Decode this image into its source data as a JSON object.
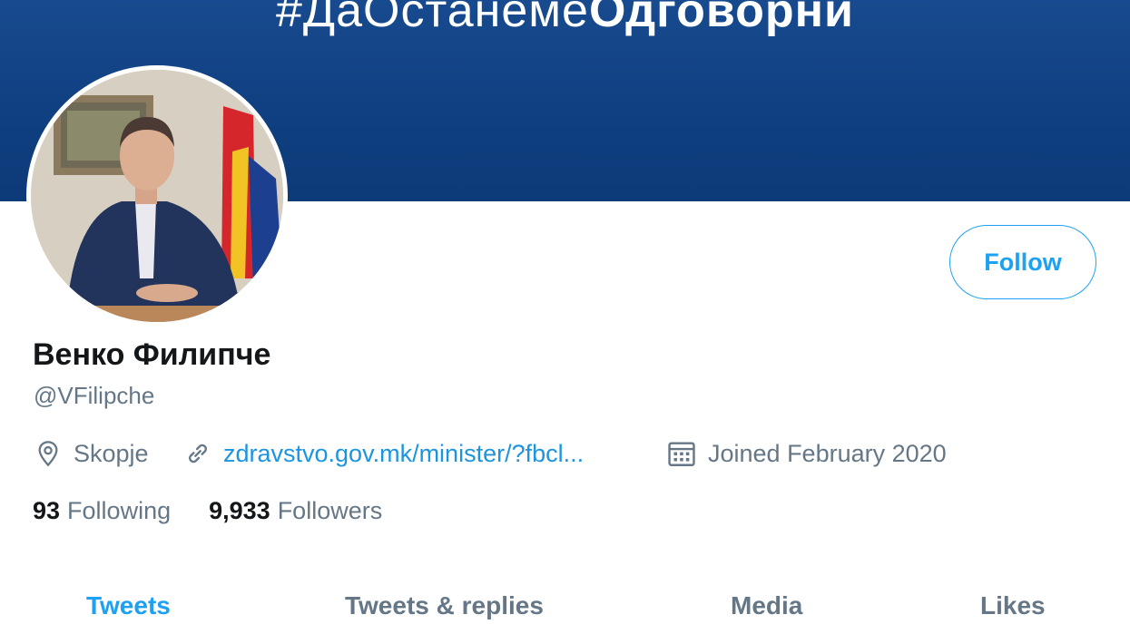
{
  "banner": {
    "hashtag_part1": "#ДаОстанеме",
    "hashtag_part2": "Одговорни"
  },
  "profile": {
    "name": "Венко Филипче",
    "handle": "@VFilipche",
    "location": "Skopje",
    "url": "zdravstvo.gov.mk/minister/?fbcl...",
    "joined": "Joined February 2020"
  },
  "stats": {
    "following_count": "93",
    "following_label": "Following",
    "followers_count": "9,933",
    "followers_label": "Followers"
  },
  "actions": {
    "follow_label": "Follow"
  },
  "tabs": [
    {
      "label": "Tweets"
    },
    {
      "label": "Tweets & replies"
    },
    {
      "label": "Media"
    },
    {
      "label": "Likes"
    }
  ],
  "colors": {
    "accent": "#1da1f2",
    "link": "#1b95e0",
    "banner": "#123f80",
    "muted": "#657786"
  }
}
